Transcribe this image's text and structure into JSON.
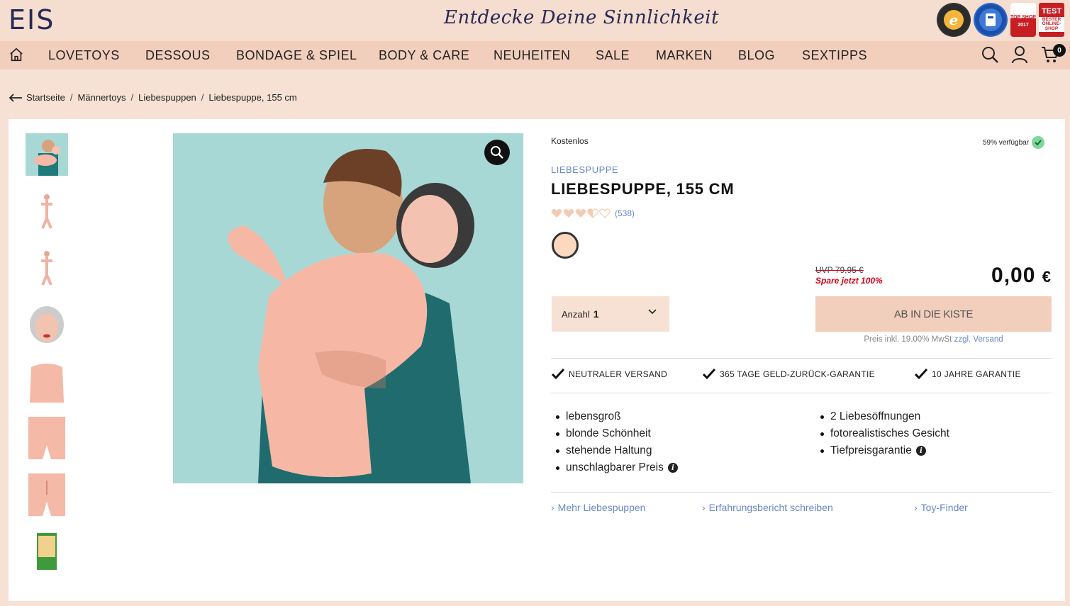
{
  "header": {
    "logo": "EIS",
    "tagline": "Entdecke Deine Sinnlichkeit",
    "badges": [
      {
        "name": "trusted-shops-badge",
        "text": "TRUSTED SHOPS GUARANTEE"
      },
      {
        "name": "bundesverband-badge",
        "text": ""
      },
      {
        "name": "computerbild-topshop-badge",
        "line1": "TOP SHOP",
        "line2": "2017"
      },
      {
        "name": "test-badge",
        "line1": "TEST",
        "line2": "BESTER ONLINE-SHOP"
      }
    ]
  },
  "nav": {
    "items": [
      "LOVETOYS",
      "DESSOUS",
      "BONDAGE & SPIEL",
      "BODY & CARE",
      "NEUHEITEN",
      "SALE",
      "MARKEN",
      "BLOG",
      "SEXTIPPS"
    ],
    "cart_count": "0"
  },
  "breadcrumb": [
    "Startseite",
    "Männertoys",
    "Liebespuppen",
    "Liebespuppe, 155 cm"
  ],
  "product": {
    "free_label": "Kostenlos",
    "stock": "59% verfügbar",
    "category": "LIEBESPUPPE",
    "title": "LIEBESPUPPE, 155 CM",
    "rating": 3.5,
    "rating_max": 5,
    "review_count": "(538)",
    "swatch_color": "#fcd8bf",
    "uvp": "UVP 79,95 €",
    "save": "Spare jetzt 100%",
    "price": "0,00",
    "currency": "€",
    "qty_label": "Anzahl",
    "qty_value": "1",
    "add_to_cart": "AB IN DIE KISTE",
    "shipping_note": "Preis inkl. 19.00% MwSt",
    "shipping_link": "zzgl. Versand"
  },
  "guarantees": [
    "NEUTRALER VERSAND",
    "365 TAGE GELD-ZURÜCK-GARANTIE",
    "10 JAHRE GARANTIE"
  ],
  "features_left": [
    "lebensgroß",
    "blonde Schönheit",
    "stehende Haltung",
    "unschlagbarer Preis"
  ],
  "features_right": [
    "2 Liebesöffnungen",
    "fotorealistisches Gesicht",
    "Tiefpreisgarantie"
  ],
  "links": [
    "Mehr Liebespuppen",
    "Erfahrungsbericht schreiben",
    "Toy-Finder"
  ],
  "colors": {
    "accent_blue": "#6a88c9",
    "peach": "#f2cfbd",
    "sale_red": "#d0021b",
    "in_stock_green": "#7fd79a"
  }
}
